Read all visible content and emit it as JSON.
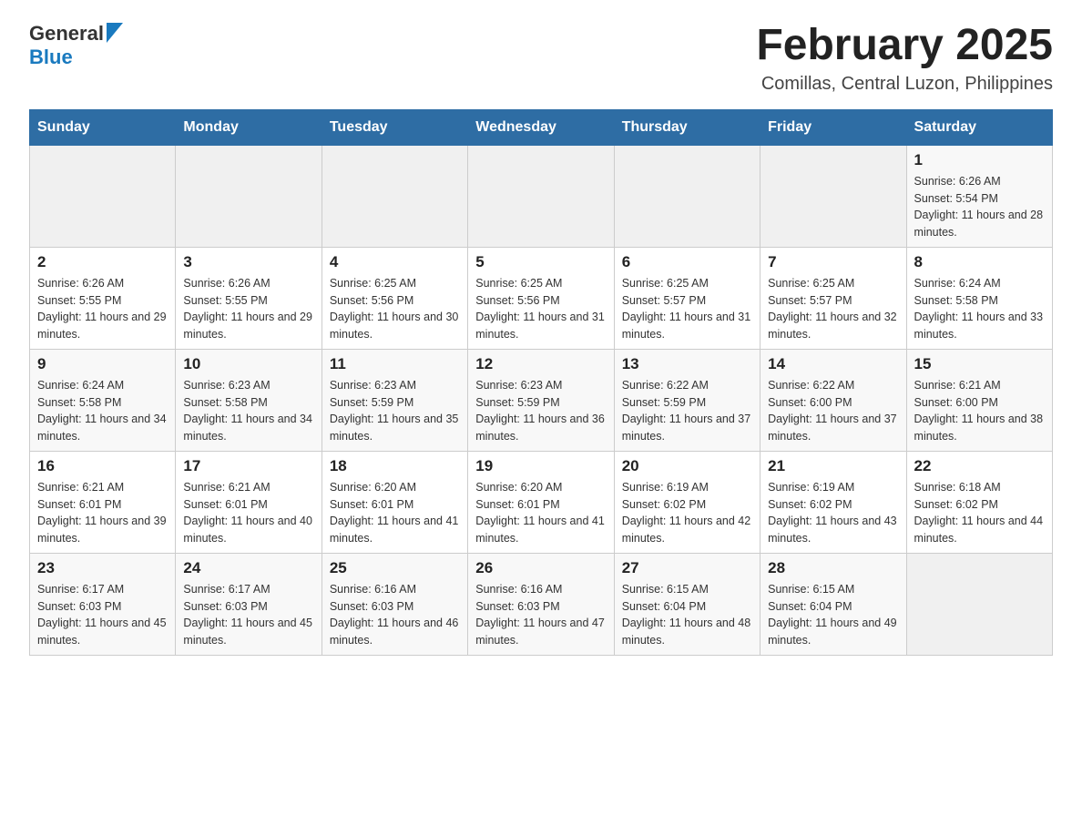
{
  "header": {
    "logo_general": "General",
    "logo_blue": "Blue",
    "month_title": "February 2025",
    "location": "Comillas, Central Luzon, Philippines"
  },
  "days_of_week": [
    "Sunday",
    "Monday",
    "Tuesday",
    "Wednesday",
    "Thursday",
    "Friday",
    "Saturday"
  ],
  "weeks": [
    {
      "days": [
        {
          "date": "",
          "sunrise": "",
          "sunset": "",
          "daylight": ""
        },
        {
          "date": "",
          "sunrise": "",
          "sunset": "",
          "daylight": ""
        },
        {
          "date": "",
          "sunrise": "",
          "sunset": "",
          "daylight": ""
        },
        {
          "date": "",
          "sunrise": "",
          "sunset": "",
          "daylight": ""
        },
        {
          "date": "",
          "sunrise": "",
          "sunset": "",
          "daylight": ""
        },
        {
          "date": "",
          "sunrise": "",
          "sunset": "",
          "daylight": ""
        },
        {
          "date": "1",
          "sunrise": "Sunrise: 6:26 AM",
          "sunset": "Sunset: 5:54 PM",
          "daylight": "Daylight: 11 hours and 28 minutes."
        }
      ]
    },
    {
      "days": [
        {
          "date": "2",
          "sunrise": "Sunrise: 6:26 AM",
          "sunset": "Sunset: 5:55 PM",
          "daylight": "Daylight: 11 hours and 29 minutes."
        },
        {
          "date": "3",
          "sunrise": "Sunrise: 6:26 AM",
          "sunset": "Sunset: 5:55 PM",
          "daylight": "Daylight: 11 hours and 29 minutes."
        },
        {
          "date": "4",
          "sunrise": "Sunrise: 6:25 AM",
          "sunset": "Sunset: 5:56 PM",
          "daylight": "Daylight: 11 hours and 30 minutes."
        },
        {
          "date": "5",
          "sunrise": "Sunrise: 6:25 AM",
          "sunset": "Sunset: 5:56 PM",
          "daylight": "Daylight: 11 hours and 31 minutes."
        },
        {
          "date": "6",
          "sunrise": "Sunrise: 6:25 AM",
          "sunset": "Sunset: 5:57 PM",
          "daylight": "Daylight: 11 hours and 31 minutes."
        },
        {
          "date": "7",
          "sunrise": "Sunrise: 6:25 AM",
          "sunset": "Sunset: 5:57 PM",
          "daylight": "Daylight: 11 hours and 32 minutes."
        },
        {
          "date": "8",
          "sunrise": "Sunrise: 6:24 AM",
          "sunset": "Sunset: 5:58 PM",
          "daylight": "Daylight: 11 hours and 33 minutes."
        }
      ]
    },
    {
      "days": [
        {
          "date": "9",
          "sunrise": "Sunrise: 6:24 AM",
          "sunset": "Sunset: 5:58 PM",
          "daylight": "Daylight: 11 hours and 34 minutes."
        },
        {
          "date": "10",
          "sunrise": "Sunrise: 6:23 AM",
          "sunset": "Sunset: 5:58 PM",
          "daylight": "Daylight: 11 hours and 34 minutes."
        },
        {
          "date": "11",
          "sunrise": "Sunrise: 6:23 AM",
          "sunset": "Sunset: 5:59 PM",
          "daylight": "Daylight: 11 hours and 35 minutes."
        },
        {
          "date": "12",
          "sunrise": "Sunrise: 6:23 AM",
          "sunset": "Sunset: 5:59 PM",
          "daylight": "Daylight: 11 hours and 36 minutes."
        },
        {
          "date": "13",
          "sunrise": "Sunrise: 6:22 AM",
          "sunset": "Sunset: 5:59 PM",
          "daylight": "Daylight: 11 hours and 37 minutes."
        },
        {
          "date": "14",
          "sunrise": "Sunrise: 6:22 AM",
          "sunset": "Sunset: 6:00 PM",
          "daylight": "Daylight: 11 hours and 37 minutes."
        },
        {
          "date": "15",
          "sunrise": "Sunrise: 6:21 AM",
          "sunset": "Sunset: 6:00 PM",
          "daylight": "Daylight: 11 hours and 38 minutes."
        }
      ]
    },
    {
      "days": [
        {
          "date": "16",
          "sunrise": "Sunrise: 6:21 AM",
          "sunset": "Sunset: 6:01 PM",
          "daylight": "Daylight: 11 hours and 39 minutes."
        },
        {
          "date": "17",
          "sunrise": "Sunrise: 6:21 AM",
          "sunset": "Sunset: 6:01 PM",
          "daylight": "Daylight: 11 hours and 40 minutes."
        },
        {
          "date": "18",
          "sunrise": "Sunrise: 6:20 AM",
          "sunset": "Sunset: 6:01 PM",
          "daylight": "Daylight: 11 hours and 41 minutes."
        },
        {
          "date": "19",
          "sunrise": "Sunrise: 6:20 AM",
          "sunset": "Sunset: 6:01 PM",
          "daylight": "Daylight: 11 hours and 41 minutes."
        },
        {
          "date": "20",
          "sunrise": "Sunrise: 6:19 AM",
          "sunset": "Sunset: 6:02 PM",
          "daylight": "Daylight: 11 hours and 42 minutes."
        },
        {
          "date": "21",
          "sunrise": "Sunrise: 6:19 AM",
          "sunset": "Sunset: 6:02 PM",
          "daylight": "Daylight: 11 hours and 43 minutes."
        },
        {
          "date": "22",
          "sunrise": "Sunrise: 6:18 AM",
          "sunset": "Sunset: 6:02 PM",
          "daylight": "Daylight: 11 hours and 44 minutes."
        }
      ]
    },
    {
      "days": [
        {
          "date": "23",
          "sunrise": "Sunrise: 6:17 AM",
          "sunset": "Sunset: 6:03 PM",
          "daylight": "Daylight: 11 hours and 45 minutes."
        },
        {
          "date": "24",
          "sunrise": "Sunrise: 6:17 AM",
          "sunset": "Sunset: 6:03 PM",
          "daylight": "Daylight: 11 hours and 45 minutes."
        },
        {
          "date": "25",
          "sunrise": "Sunrise: 6:16 AM",
          "sunset": "Sunset: 6:03 PM",
          "daylight": "Daylight: 11 hours and 46 minutes."
        },
        {
          "date": "26",
          "sunrise": "Sunrise: 6:16 AM",
          "sunset": "Sunset: 6:03 PM",
          "daylight": "Daylight: 11 hours and 47 minutes."
        },
        {
          "date": "27",
          "sunrise": "Sunrise: 6:15 AM",
          "sunset": "Sunset: 6:04 PM",
          "daylight": "Daylight: 11 hours and 48 minutes."
        },
        {
          "date": "28",
          "sunrise": "Sunrise: 6:15 AM",
          "sunset": "Sunset: 6:04 PM",
          "daylight": "Daylight: 11 hours and 49 minutes."
        },
        {
          "date": "",
          "sunrise": "",
          "sunset": "",
          "daylight": ""
        }
      ]
    }
  ]
}
